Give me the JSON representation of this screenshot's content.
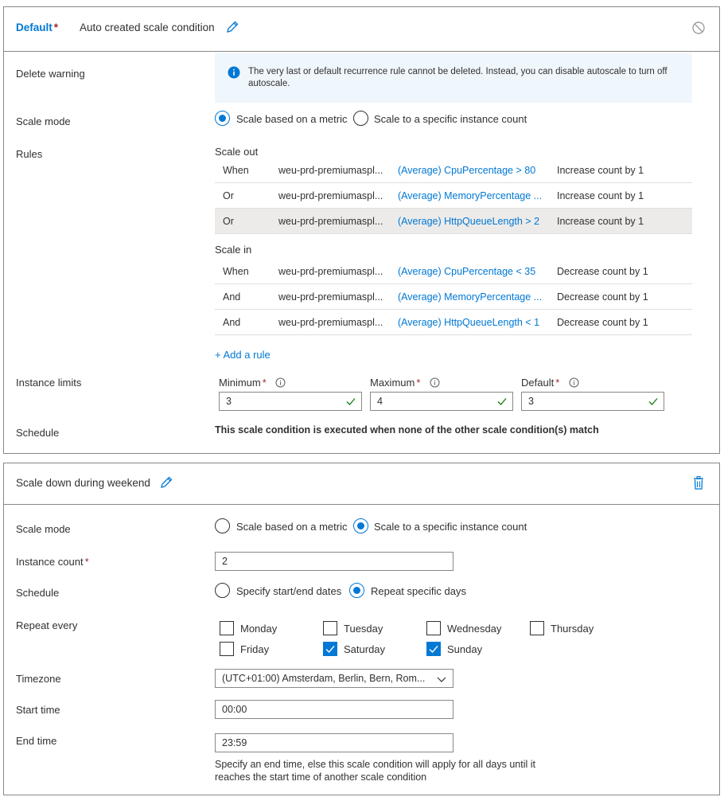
{
  "default_condition": {
    "badge": "Default",
    "required_mark": "*",
    "title": "Auto created scale condition",
    "delete_warning_label": "Delete warning",
    "delete_warning_text": "The very last or default recurrence rule cannot be deleted. Instead, you can disable autoscale to turn off autoscale.",
    "scale_mode_label": "Scale mode",
    "scale_mode_options": [
      "Scale based on a metric",
      "Scale to a specific instance count"
    ],
    "scale_mode_selected": "Scale based on a metric",
    "rules_label": "Rules",
    "scale_out_title": "Scale out",
    "scale_out_rules": [
      {
        "op": "When",
        "resource": "weu-prd-premiumaspl...",
        "metric": "(Average) CpuPercentage > 80",
        "action": "Increase count by 1"
      },
      {
        "op": "Or",
        "resource": "weu-prd-premiumaspl...",
        "metric": "(Average) MemoryPercentage ...",
        "action": "Increase count by 1"
      },
      {
        "op": "Or",
        "resource": "weu-prd-premiumaspl...",
        "metric": "(Average) HttpQueueLength > 2",
        "action": "Increase count by 1"
      }
    ],
    "scale_in_title": "Scale in",
    "scale_in_rules": [
      {
        "op": "When",
        "resource": "weu-prd-premiumaspl...",
        "metric": "(Average) CpuPercentage < 35",
        "action": "Decrease count by 1"
      },
      {
        "op": "And",
        "resource": "weu-prd-premiumaspl...",
        "metric": "(Average) MemoryPercentage ...",
        "action": "Decrease count by 1"
      },
      {
        "op": "And",
        "resource": "weu-prd-premiumaspl...",
        "metric": "(Average) HttpQueueLength < 1",
        "action": "Decrease count by 1"
      }
    ],
    "add_rule": "+ Add a rule",
    "instance_limits_label": "Instance limits",
    "minimum_label": "Minimum",
    "minimum_value": "3",
    "maximum_label": "Maximum",
    "maximum_value": "4",
    "default_label": "Default",
    "default_value": "3",
    "schedule_label": "Schedule",
    "schedule_text": "This scale condition is executed when none of the other scale condition(s) match"
  },
  "weekend_condition": {
    "title": "Scale down during weekend",
    "scale_mode_label": "Scale mode",
    "scale_mode_options": [
      "Scale based on a metric",
      "Scale to a specific instance count"
    ],
    "scale_mode_selected": "Scale to a specific instance count",
    "instance_count_label": "Instance count",
    "instance_count_value": "2",
    "schedule_label": "Schedule",
    "schedule_options": [
      "Specify start/end dates",
      "Repeat specific days"
    ],
    "schedule_selected": "Repeat specific days",
    "repeat_every_label": "Repeat every",
    "days": [
      {
        "name": "Monday",
        "checked": false
      },
      {
        "name": "Tuesday",
        "checked": false
      },
      {
        "name": "Wednesday",
        "checked": false
      },
      {
        "name": "Thursday",
        "checked": false
      },
      {
        "name": "Friday",
        "checked": false
      },
      {
        "name": "Saturday",
        "checked": true
      },
      {
        "name": "Sunday",
        "checked": true
      }
    ],
    "timezone_label": "Timezone",
    "timezone_value": "(UTC+01:00) Amsterdam, Berlin, Bern, Rom...",
    "start_time_label": "Start time",
    "start_time_value": "00:00",
    "end_time_label": "End time",
    "end_time_value": "23:59",
    "end_time_hint": "Specify an end time, else this scale condition will apply for all days until it reaches the start time of another scale condition"
  },
  "colors": {
    "accent": "#0078d4",
    "required": "#a4262c",
    "valid_check": "#107c10",
    "info_bg": "#eff6fc",
    "row_highlight": "#edebe9"
  }
}
